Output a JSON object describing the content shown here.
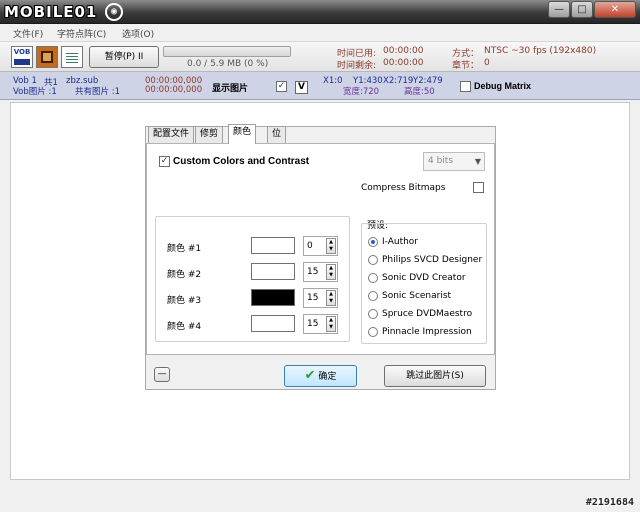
{
  "window": {
    "logo_text": "MOBILE01",
    "logo_badge": "◉",
    "controls": {
      "minimize": "—",
      "maximize": "□",
      "close": "✕"
    }
  },
  "menu": [
    {
      "label": "文件(F)"
    },
    {
      "label": "字符点阵(C)"
    },
    {
      "label": "选项(O)"
    }
  ],
  "toolbar": {
    "icons": [
      "vob-icon",
      "film-icon",
      "grid-icon"
    ],
    "vob_icon_text": "VOB",
    "pause_label": "暂停(P) II",
    "progress_fraction": 0.0,
    "progress_text": "0.0 / 5.9 MB (0 %)",
    "time_used_label": "时间已用:",
    "time_used_value": "00:00:00",
    "time_left_label": "时间剩余:",
    "time_left_value": "00:00:00",
    "format_label": "方式：",
    "format_value": "NTSC ~30 fps (192x480)",
    "chapter_label": "章节：",
    "chapter_value": "0"
  },
  "info": {
    "vob_line1": "Vob 1",
    "total_label": "共1",
    "file": "zbz.sub",
    "vob_pic": "Vob图片 :1",
    "total_pics": "共有图片 :1",
    "time1": "00:00:00,000",
    "time2": "00:00:00,000",
    "show_pic": "显示图片",
    "show_pic_checked": true,
    "v_label": "V",
    "x_value": "X1:0",
    "y1": "Y1:430",
    "x2": "X2:719",
    "y2": "Y2:479",
    "width": "宽度:720",
    "height": "高度:50",
    "debug": "Debug Matrix",
    "debug_checked": false
  },
  "dialog": {
    "tabs": [
      "配置文件",
      "修剪",
      "颜色",
      "位"
    ],
    "active_tab": "颜色",
    "custom_colors": "Custom Colors and Contrast",
    "custom_colors_checked": true,
    "bits": "4 bits",
    "compress": "Compress Bitmaps",
    "compress_checked": false,
    "colors": [
      {
        "label": "颜色 #1",
        "color": "#ffffff",
        "value": "0"
      },
      {
        "label": "颜色 #2",
        "color": "#ffffff",
        "value": "15"
      },
      {
        "label": "颜色 #3",
        "color": "#000000",
        "value": "15"
      },
      {
        "label": "颜色 #4",
        "color": "#ffffff",
        "value": "15"
      }
    ],
    "presets_title": "预设:",
    "presets": [
      "I-Author",
      "Philips SVCD Designer",
      "Sonic DVD Creator",
      "Sonic Scenarist",
      "Spruce DVDMaestro",
      "Pinnacle Impression"
    ],
    "selected_preset": "I-Author",
    "collapse": "—",
    "ok": "确定",
    "skip": "跳过此图片(S)"
  },
  "watermark": "#2191684"
}
